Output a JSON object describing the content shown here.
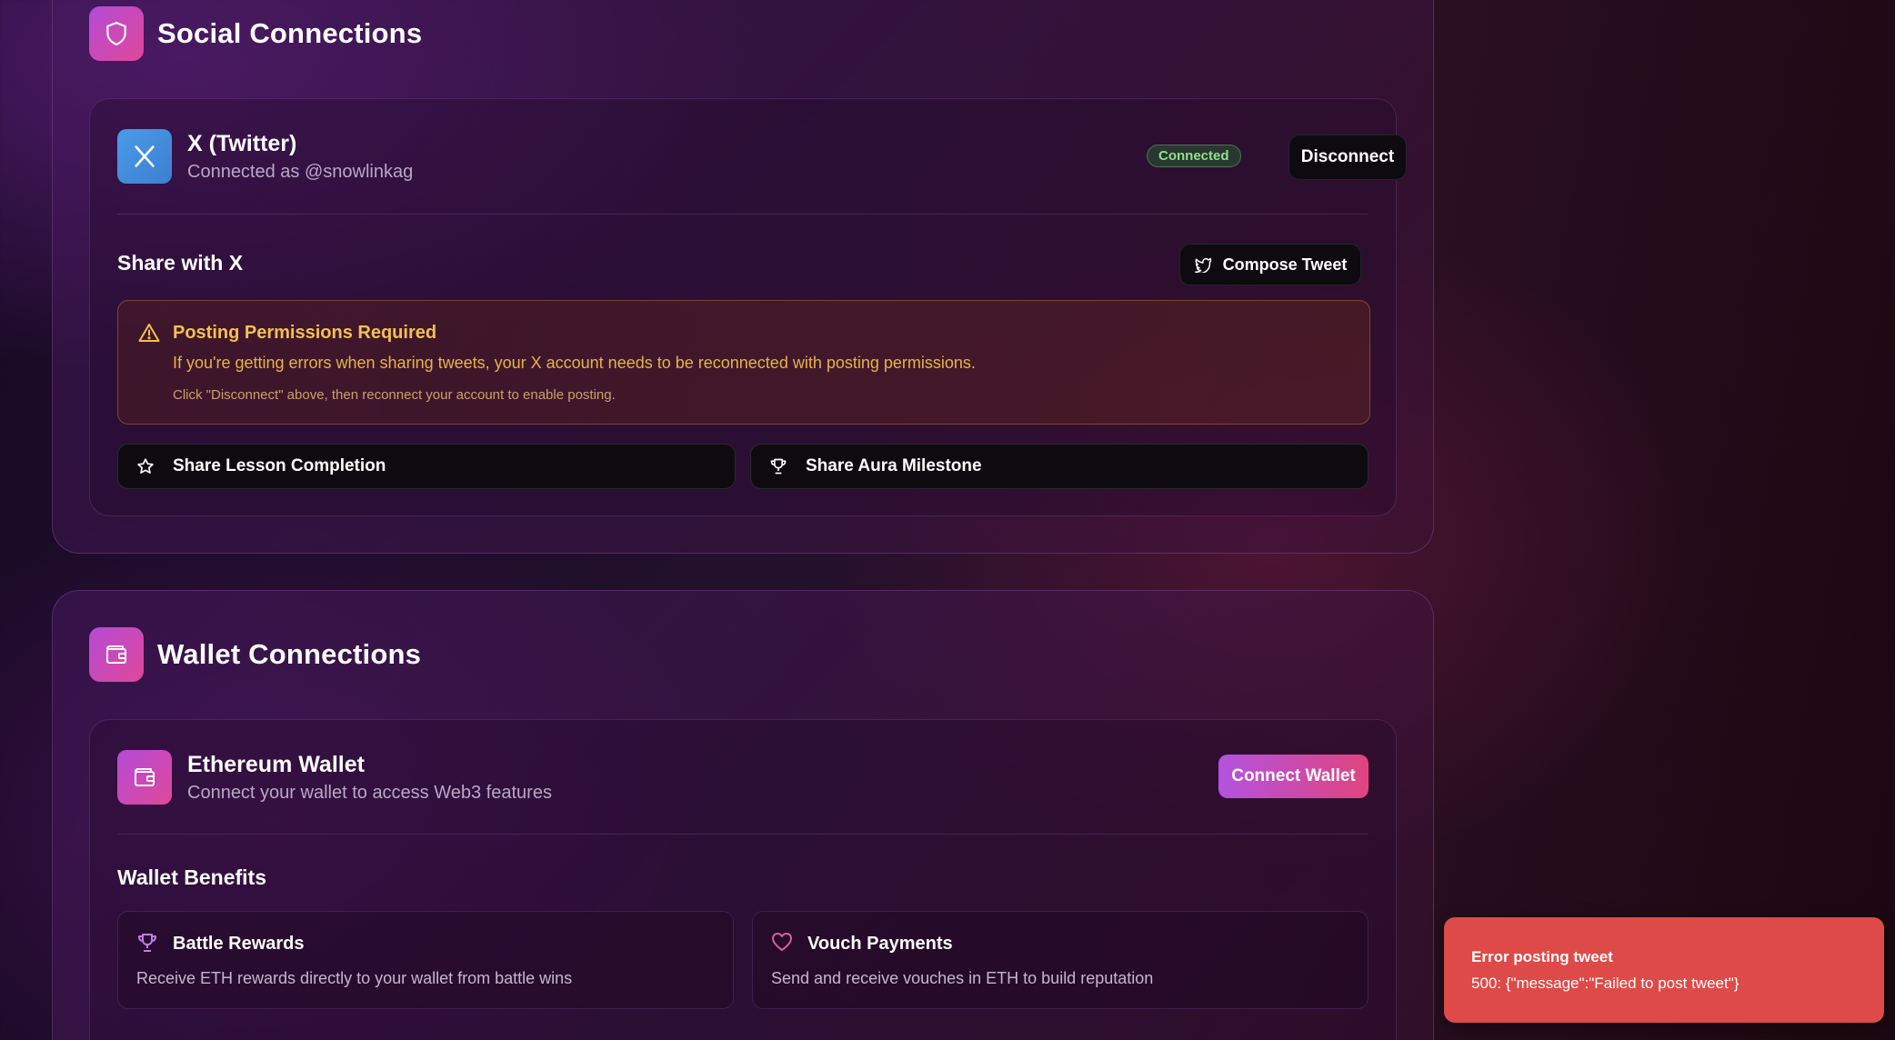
{
  "social": {
    "title": "Social Connections",
    "icon": "shield-icon",
    "twitter": {
      "name": "X (Twitter)",
      "status_text": "Connected as @snowlinkag",
      "badge": "Connected",
      "disconnect_label": "Disconnect",
      "share_heading": "Share with X",
      "compose_label": "Compose Tweet",
      "warning": {
        "title": "Posting Permissions Required",
        "body": "If you're getting errors when sharing tweets, your X account needs to be reconnected with posting permissions.",
        "hint": "Click \"Disconnect\" above, then reconnect your account to enable posting."
      },
      "share_lesson_label": "Share Lesson Completion",
      "share_aura_label": "Share Aura Milestone"
    }
  },
  "wallet": {
    "title": "Wallet Connections",
    "icon": "wallet-icon",
    "ethereum": {
      "name": "Ethereum Wallet",
      "description": "Connect your wallet to access Web3 features",
      "connect_label": "Connect Wallet"
    },
    "benefits_heading": "Wallet Benefits",
    "benefits": [
      {
        "title": "Battle Rewards",
        "description": "Receive ETH rewards directly to your wallet from battle wins",
        "icon": "trophy-icon"
      },
      {
        "title": "Vouch Payments",
        "description": "Send and receive vouches in ETH to build reputation",
        "icon": "heart-icon"
      }
    ]
  },
  "toast": {
    "title": "Error posting tweet",
    "message": "500: {\"message\":\"Failed to post tweet\"}"
  },
  "colors": {
    "accent_gradient_start": "#b44bd6",
    "accent_gradient_end": "#e0479a",
    "connected_badge": "#8fe08f",
    "warning": "#f2c14e",
    "toast_bg": "#de4a48"
  }
}
